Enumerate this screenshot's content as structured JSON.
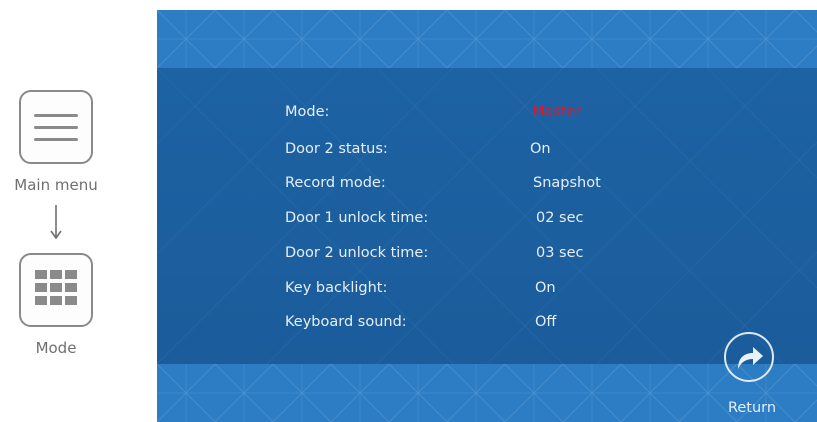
{
  "instructions": {
    "main_menu_label": "Main menu",
    "mode_label": "Mode",
    "main_menu_icon": "hamburger-menu-icon",
    "mode_icon": "grid-icon",
    "arrow_icon": "arrow-down-icon"
  },
  "screen": {
    "settings": [
      {
        "label": "Mode:",
        "value": "Master",
        "highlighted": true
      },
      {
        "label": "Door 2 status:",
        "value": "On",
        "highlighted": false
      },
      {
        "label": "Record mode:",
        "value": "Snapshot",
        "highlighted": false
      },
      {
        "label": "Door 1 unlock time:",
        "value": "02 sec",
        "highlighted": false
      },
      {
        "label": "Door 2 unlock time:",
        "value": "03 sec",
        "highlighted": false
      },
      {
        "label": "Key backlight:",
        "value": "On",
        "highlighted": false
      },
      {
        "label": "Keyboard sound:",
        "value": "Off",
        "highlighted": false
      }
    ],
    "return_label": "Return",
    "return_icon": "return-arrow-icon"
  },
  "colors": {
    "screen_bg": "#1a5e9d",
    "band_bg": "#2d7dc4",
    "text": "#e6eef7",
    "highlight": "#e0182b"
  }
}
